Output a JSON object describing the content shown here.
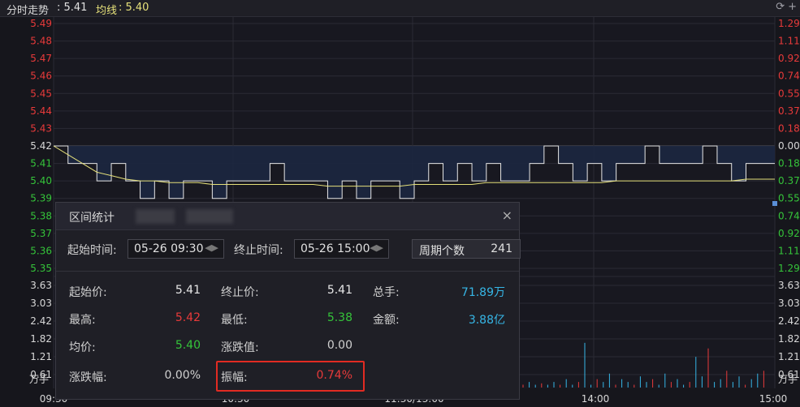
{
  "header": {
    "label": "分时走势",
    "price_value": ": 5.41",
    "avg_label": "均线",
    "avg_value": ": 5.40",
    "refresh_icon": "refresh-icon",
    "add_icon": "plus-icon"
  },
  "axis": {
    "left_price_ticks": [
      "5.49",
      "5.48",
      "5.47",
      "5.46",
      "5.45",
      "5.44",
      "5.43",
      "5.42",
      "5.41",
      "5.40",
      "5.39",
      "5.38",
      "5.37",
      "5.36",
      "5.35"
    ],
    "right_pct_ticks": [
      "1.29%",
      "1.11%",
      "0.92%",
      "0.74%",
      "0.55%",
      "0.37%",
      "0.18%",
      "0.00%",
      "0.18%",
      "0.37%",
      "0.55%",
      "0.74%",
      "0.92%",
      "1.11%",
      "1.29%"
    ],
    "volume_ticks": [
      "3.63",
      "3.03",
      "2.42",
      "1.82",
      "1.21",
      "0.61"
    ],
    "volume_unit": "万手",
    "time_ticks": [
      "09:30",
      "10:30",
      "11:30/13:00",
      "14:00",
      "15:00"
    ]
  },
  "chart_data": {
    "type": "line",
    "prev_close": 5.42,
    "ylim": [
      5.35,
      5.49
    ],
    "series": [
      {
        "values": [
          5.42,
          5.41,
          5.41,
          5.4,
          5.41,
          5.4,
          5.39,
          5.4,
          5.39,
          5.4,
          5.4,
          5.39,
          5.4,
          5.4,
          5.4,
          5.41,
          5.4,
          5.4,
          5.4,
          5.39,
          5.4,
          5.39,
          5.4,
          5.4,
          5.39,
          5.4,
          5.41,
          5.4,
          5.41,
          5.4,
          5.41,
          5.4,
          5.4,
          5.41,
          5.42,
          5.41,
          5.4,
          5.41,
          5.4,
          5.41,
          5.41,
          5.42,
          5.41,
          5.41,
          5.41,
          5.42,
          5.41,
          5.4,
          5.41,
          5.41,
          5.41
        ]
      },
      {
        "values": [
          5.42,
          5.415,
          5.41,
          5.405,
          5.403,
          5.401,
          5.4,
          5.4,
          5.399,
          5.399,
          5.399,
          5.398,
          5.398,
          5.398,
          5.398,
          5.398,
          5.398,
          5.398,
          5.398,
          5.397,
          5.397,
          5.397,
          5.397,
          5.397,
          5.397,
          5.398,
          5.398,
          5.398,
          5.398,
          5.398,
          5.399,
          5.399,
          5.399,
          5.399,
          5.399,
          5.399,
          5.399,
          5.399,
          5.399,
          5.4,
          5.4,
          5.4,
          5.4,
          5.4,
          5.4,
          5.4,
          5.4,
          5.4,
          5.401,
          5.401,
          5.401
        ]
      }
    ],
    "volume": [
      0.1,
      0.2,
      0.1,
      0.15,
      0.1,
      0.2,
      0.1,
      0.3,
      0.1,
      0.2,
      1.6,
      0.1,
      0.3,
      0.2,
      0.5,
      0.1,
      0.3,
      0.2,
      0.1,
      0.4,
      0.2,
      0.3,
      0.1,
      0.5,
      0.2,
      0.3,
      0.1,
      0.2,
      1.1,
      0.4,
      1.4,
      0.2,
      0.3,
      0.6,
      0.2,
      0.4,
      0.1,
      0.3,
      0.5,
      0.6
    ]
  },
  "dialog": {
    "title": "区间统计",
    "close": "×",
    "start_label": "起始时间:",
    "start_value": "05-26 09:30",
    "end_label": "终止时间:",
    "end_value": "05-26 15:00",
    "period_label": "周期个数",
    "period_value": "241",
    "stats": {
      "start_price_label": "起始价:",
      "start_price": "5.41",
      "end_price_label": "终止价:",
      "end_price": "5.41",
      "total_hands_label": "总手:",
      "total_hands": "71.89万",
      "high_label": "最高:",
      "high": "5.42",
      "low_label": "最低:",
      "low": "5.38",
      "amount_label": "金额:",
      "amount": "3.88亿",
      "avg_label": "均价:",
      "avg": "5.40",
      "change_label": "涨跌值:",
      "change": "0.00",
      "change_pct_label": "涨跌幅:",
      "change_pct": "0.00%",
      "amplitude_label": "振幅:",
      "amplitude": "0.74%"
    },
    "colors": {
      "red": "#e83a3a",
      "green": "#35c43a",
      "cyan": "#36b6e6",
      "white": "#e8e8e8"
    }
  }
}
